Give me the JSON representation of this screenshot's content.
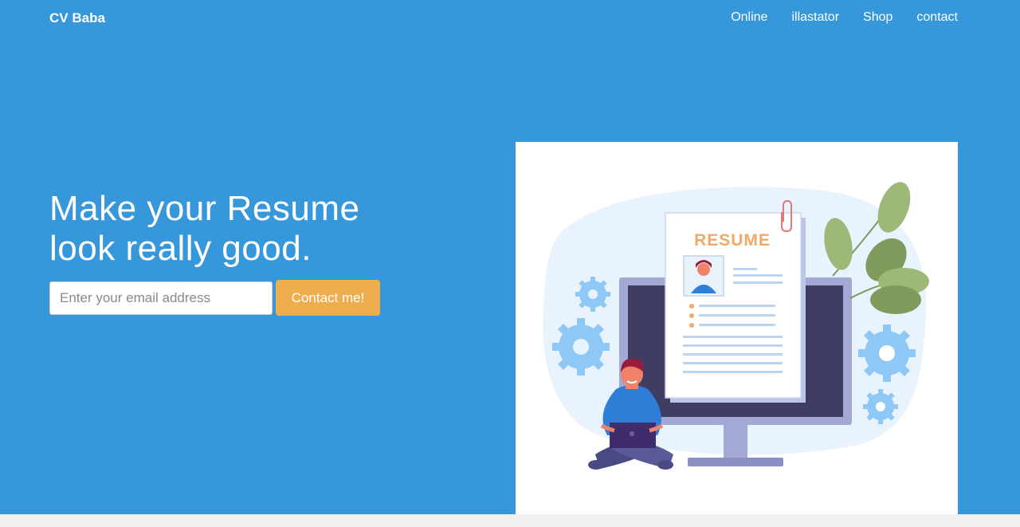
{
  "brand": "CV Baba",
  "nav": [
    "Online",
    "illastator",
    "Shop",
    "contact"
  ],
  "hero": {
    "headline_line1": "Make your Resume",
    "headline_line2": "look really good.",
    "email_placeholder": "Enter your email address",
    "cta_label": "Contact me!"
  },
  "illustration": {
    "resume_title": "RESUME"
  },
  "colors": {
    "hero_bg": "#3797db",
    "cta": "#f0ad4e",
    "card": "#ffffff"
  }
}
